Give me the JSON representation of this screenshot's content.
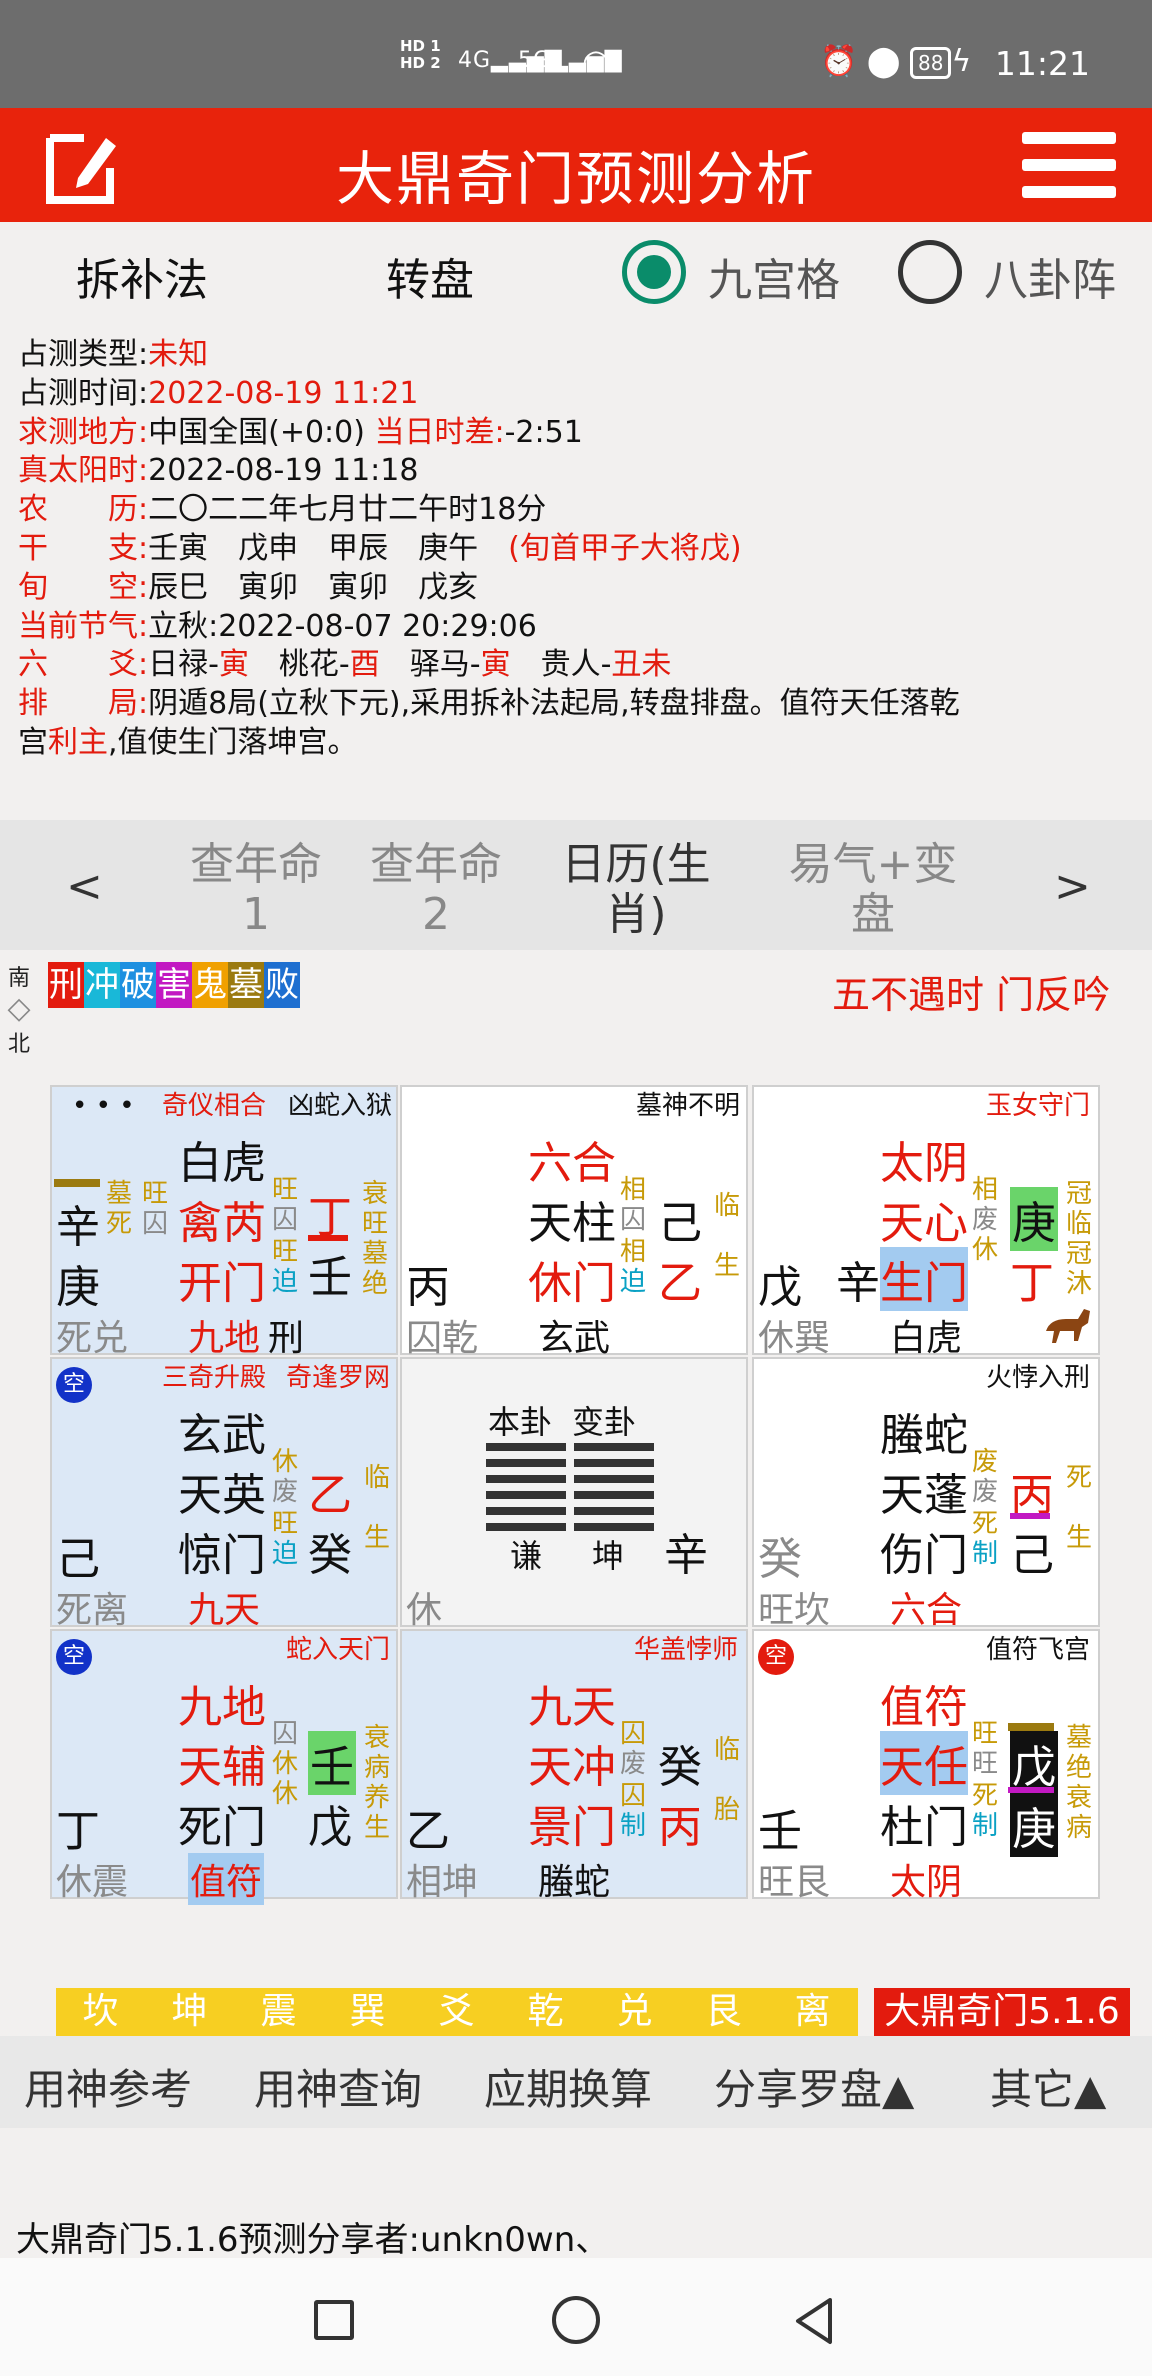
{
  "status": {
    "time": "11:21",
    "hd1": "HD 1",
    "hd2": "HD 2",
    "net1": "4G",
    "net2": "5G",
    "battery": "88"
  },
  "header": {
    "title": "大鼎奇门预测分析"
  },
  "options": {
    "method": "拆补法",
    "plate": "转盘",
    "radio1": "九宫格",
    "radio2": "八卦阵"
  },
  "info": {
    "l1": "占测类型:",
    "v1": "未知",
    "l2": "占测时间:",
    "v2": "2022-08-19 11:21",
    "l3": "求测地方:",
    "v3": "中国全国(+0:0)",
    "l3b": "当日时差:",
    "v3b": "-2:51",
    "l4": "真太阳时:",
    "v4": "2022-08-19 11:18",
    "l5": "农　　历:",
    "v5": "二〇二二年七月廿二午时18分",
    "l6": "干　　支:",
    "v6": "壬寅　戊申　甲辰　庚午",
    "v6b": "(旬首甲子大将戊)",
    "l7": "旬　　空:",
    "v7": "辰巳　寅卯　寅卯　戊亥",
    "l8": "当前节气:",
    "v8": "立秋:2022-08-07 20:29:06",
    "l9": "六　　爻:",
    "v9a": "日禄-",
    "v9b": "寅",
    "v9c": "　桃花-",
    "v9d": "酉",
    "v9e": "　驿马-",
    "v9f": "寅",
    "v9g": "　贵人-",
    "v9h": "丑未",
    "l10": "排　　局:",
    "v10": "阴遁8局(立秋下元),采用拆补法起局,转盘排盘。值符天任落乾",
    "v11a": "宫",
    "v11b": "利主",
    "v11c": ",值使生门落坤宫。"
  },
  "nav": {
    "prev": "<",
    "next": ">",
    "t1a": "查年命",
    "t1b": "1",
    "t2a": "查年命",
    "t2b": "2",
    "t3a": "日历(生",
    "t3b": "肖)",
    "t4a": "易气+变",
    "t4b": "盘"
  },
  "legend": {
    "items": [
      "刑",
      "冲",
      "破",
      "害",
      "鬼",
      "墓",
      "败"
    ],
    "colors": [
      "#e31b0e",
      "#19b8d8",
      "#1e90e0",
      "#c219c2",
      "#f0a000",
      "#9b7a10",
      "#1e6fd0"
    ]
  },
  "compass": {
    "s": "南",
    "n": "北"
  },
  "notice": "五不遇时 门反吟",
  "palaces": {
    "p1": {
      "tag1": "奇仪相合",
      "tag2": "凶蛇入狱",
      "dots": "• • •",
      "god": "白虎",
      "star": "禽芮",
      "door": "开门",
      "deity": "九地",
      "tian": "丁",
      "di": "壬",
      "left1": "辛",
      "left2": "庚",
      "pal": "死兑",
      "c1": "墓",
      "c2": "死",
      "c3": "旺",
      "c4": "囚",
      "c5": "旺",
      "c6": "囚",
      "c7": "旺",
      "c8": "迫",
      "r1": "衰",
      "r2": "旺",
      "r3": "墓",
      "r4": "绝",
      "mark": "刑"
    },
    "p2": {
      "tag": "墓神不明",
      "god": "六合",
      "star": "天柱",
      "door": "休门",
      "deity": "玄武",
      "tian": "己",
      "di": "乙",
      "left": "丙",
      "pal": "囚乾",
      "c1": "相",
      "c2": "囚",
      "c3": "相",
      "c4": "迫",
      "r1": "临",
      "r2": "生"
    },
    "p3": {
      "tag": "玉女守门",
      "god": "太阴",
      "star": "天心",
      "door": "生门",
      "deity": "白虎",
      "tian": "庚",
      "di": "丁",
      "left": "戊",
      "mid": "辛",
      "pal": "休巽",
      "c1": "相",
      "c2": "废",
      "c3": "休",
      "r1": "冠",
      "r2": "临",
      "r3": "冠",
      "r4": "沐"
    },
    "p4": {
      "tag1": "三奇升殿",
      "tag2": "奇逢罗网",
      "kong": "空",
      "god": "玄武",
      "star": "天英",
      "door": "惊门",
      "deity": "九天",
      "tian": "乙",
      "di": "癸",
      "left": "己",
      "pal": "死离",
      "c1": "休",
      "c2": "废",
      "c3": "旺",
      "c4": "迫",
      "r1": "临",
      "r2": "生"
    },
    "p5": {
      "h1": "本卦",
      "h2": "变卦",
      "g1": "谦",
      "g2": "坤",
      "left": "休",
      "right": "辛"
    },
    "p6": {
      "tag": "火悖入刑",
      "god": "螣蛇",
      "star": "天蓬",
      "door": "伤门",
      "deity": "六合",
      "tian": "丙",
      "di": "己",
      "left": "癸",
      "pal": "旺坎",
      "c1": "废",
      "c2": "废",
      "c3": "死",
      "c4": "制",
      "r1": "死",
      "r2": "生"
    },
    "p7": {
      "tag": "蛇入天门",
      "kong": "空",
      "god": "九地",
      "star": "天辅",
      "door": "死门",
      "deity": "值符",
      "tian": "壬",
      "di": "戊",
      "left": "丁",
      "pal": "休震",
      "c1": "囚",
      "c2": "休",
      "c3": "休",
      "r1": "衰",
      "r2": "病",
      "r3": "养",
      "r4": "生"
    },
    "p8": {
      "tag": "华盖悖师",
      "god": "九天",
      "star": "天冲",
      "door": "景门",
      "deity": "螣蛇",
      "tian": "癸",
      "di": "丙",
      "left": "乙",
      "pal": "相坤",
      "c1": "囚",
      "c2": "废",
      "c3": "囚",
      "c4": "制",
      "r1": "临",
      "r2": "胎"
    },
    "p9": {
      "tag": "值符飞宫",
      "kong": "空",
      "god": "值符",
      "star": "天任",
      "door": "杜门",
      "deity": "太阴",
      "tian": "戊",
      "di": "庚",
      "left": "壬",
      "pal": "旺艮",
      "c1": "旺",
      "c2": "旺",
      "c3": "死",
      "c4": "制",
      "r1": "墓",
      "r2": "绝",
      "r3": "衰",
      "r4": "病"
    }
  },
  "trigrams": [
    "坎",
    "坤",
    "震",
    "巽",
    "爻",
    "乾",
    "兑",
    "艮",
    "离"
  ],
  "version": "大鼎奇门5.1.6",
  "bottom": {
    "b1": "用神参考",
    "b2": "用神查询",
    "b3": "应期换算",
    "b4": "分享罗盘▲",
    "b5": "其它▲"
  },
  "share": "大鼎奇门5.1.6预测分享者:unkn0wn、"
}
